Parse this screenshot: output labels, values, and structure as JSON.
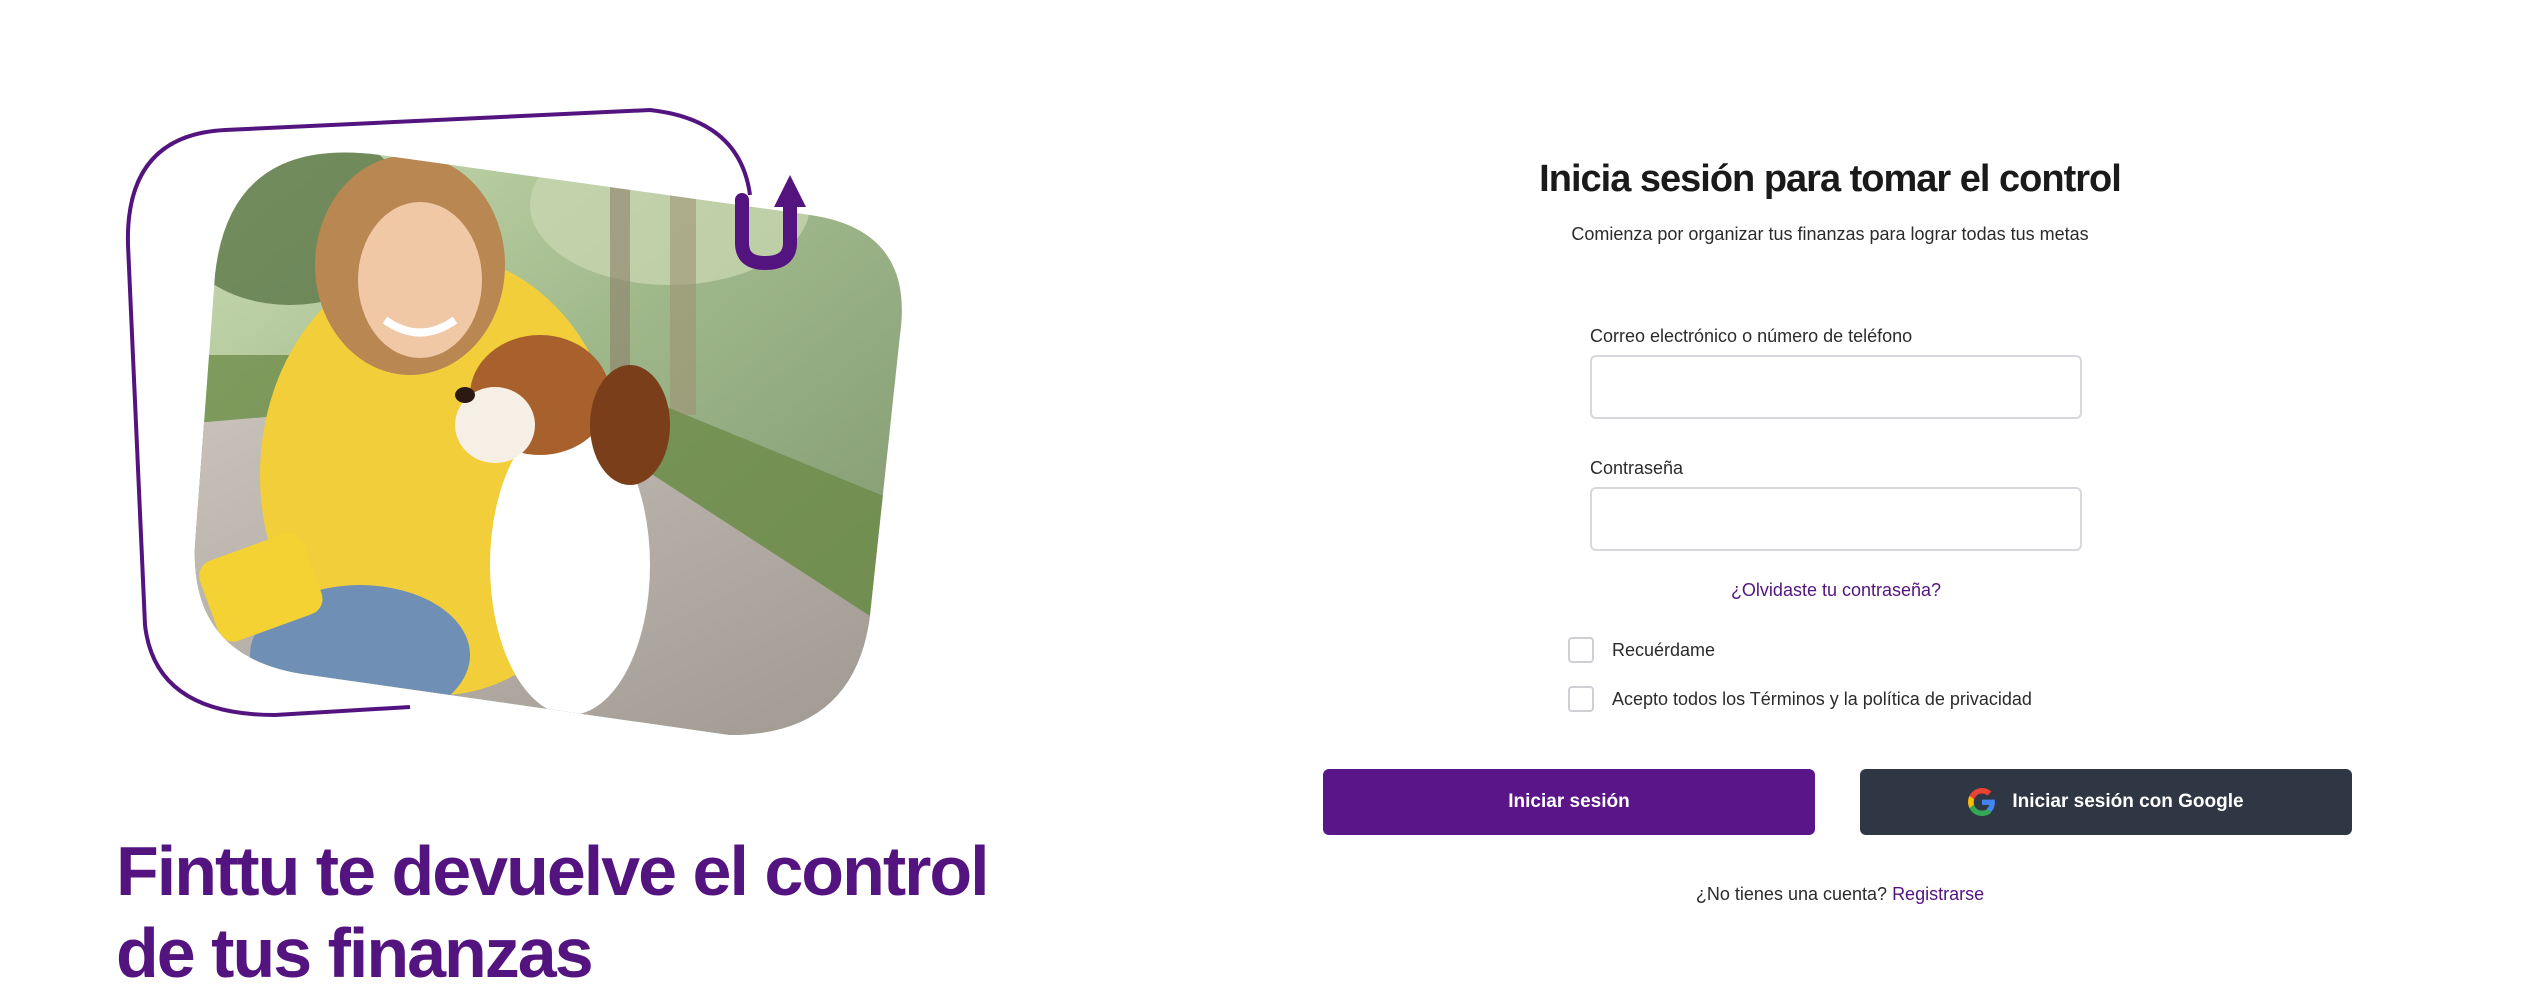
{
  "hero": {
    "title_line1": "Finttu te devuelve el control",
    "title_line2": "de tus finanzas",
    "accent_color": "#54147f"
  },
  "login": {
    "title": "Inicia sesión para tomar el control",
    "subtitle": "Comienza por organizar tus finanzas para lograr todas tus metas",
    "email_label": "Correo electrónico o número de teléfono",
    "email_value": "",
    "password_label": "Contraseña",
    "password_value": "",
    "forgot_link": "¿Olvidaste tu contraseña?",
    "remember_label": "Recuérdame",
    "terms_label": "Acepto todos los Términos y la política de privacidad",
    "login_button": "Iniciar sesión",
    "google_button": "Iniciar sesión con Google",
    "google_icon": "google-g-icon",
    "no_account_text": "¿No tienes una cuenta?",
    "signup_link": "Registrarse"
  },
  "colors": {
    "primary": "#5a1688",
    "google_button_bg": "#2f3744",
    "input_border": "#d7d7dd",
    "text": "#1a1a1a"
  }
}
